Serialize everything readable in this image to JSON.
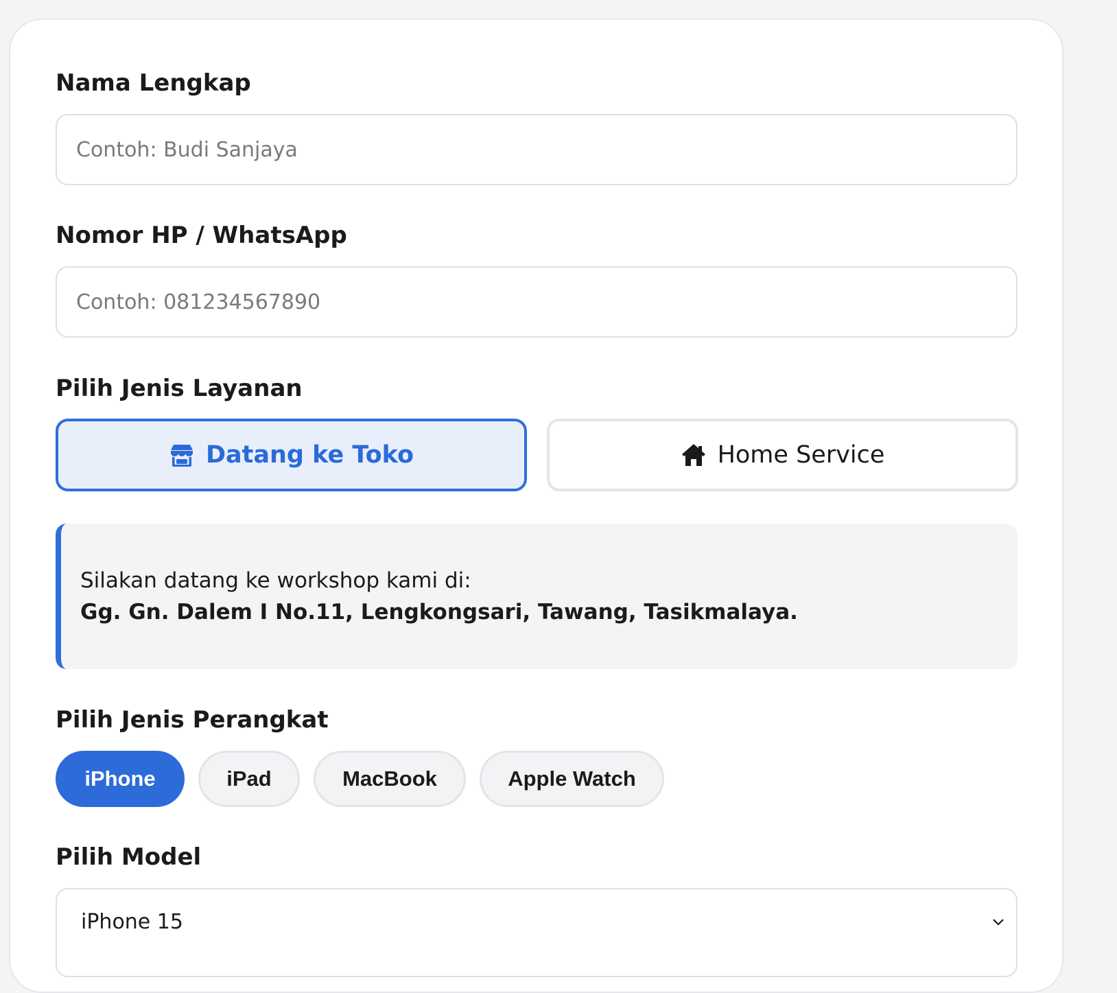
{
  "form": {
    "name_field": {
      "label": "Nama Lengkap",
      "placeholder": "Contoh: Budi Sanjaya"
    },
    "phone_field": {
      "label": "Nomor HP / WhatsApp",
      "placeholder": "Contoh: 081234567890"
    },
    "service_type": {
      "label": "Pilih Jenis Layanan",
      "options": [
        {
          "label": "Datang ke Toko",
          "icon": "store-icon",
          "selected": true
        },
        {
          "label": "Home Service",
          "icon": "home-icon",
          "selected": false
        }
      ]
    },
    "info": {
      "intro": "Silakan datang ke workshop kami di:",
      "address": "Gg. Gn. Dalem I No.11, Lengkongsari, Tawang, Tasikmalaya."
    },
    "device_type": {
      "label": "Pilih Jenis Perangkat",
      "options": [
        {
          "label": "iPhone",
          "selected": true
        },
        {
          "label": "iPad",
          "selected": false
        },
        {
          "label": "MacBook",
          "selected": false
        },
        {
          "label": "Apple Watch",
          "selected": false
        }
      ]
    },
    "model": {
      "label": "Pilih Model",
      "selected_value": "iPhone 15"
    }
  },
  "colors": {
    "accent": "#2d6bd9",
    "accent_light": "#e8effb",
    "page_bg": "#f3f4f6",
    "info_bg": "#f4f4f6"
  }
}
